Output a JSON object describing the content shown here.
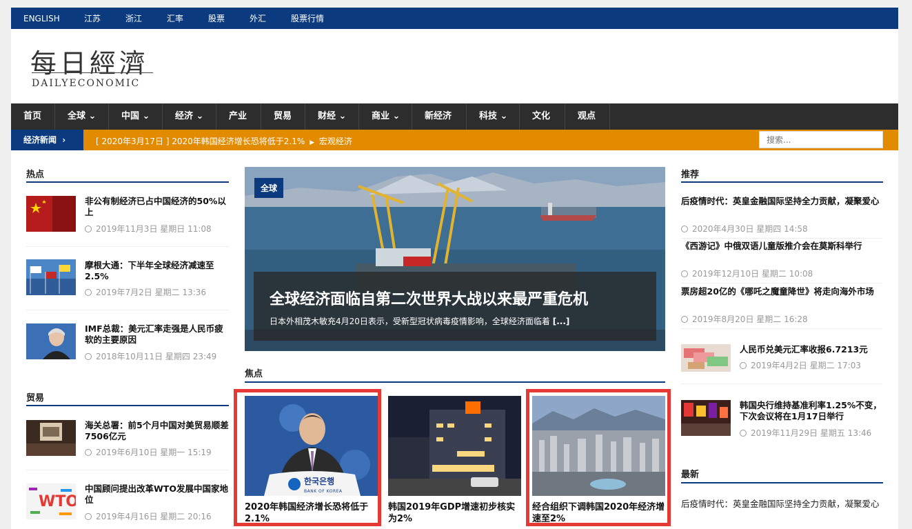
{
  "topbar": {
    "items": [
      "ENGLISH",
      "江苏",
      "浙江",
      "汇率",
      "股票",
      "外汇",
      "股票行情"
    ]
  },
  "logo": {
    "cn": "每日經濟",
    "en": "DAILYECONOMIC"
  },
  "nav": {
    "items": [
      "首页",
      "全球",
      "中国",
      "经济",
      "产业",
      "贸易",
      "财经",
      "商业",
      "新经济",
      "科技",
      "文化",
      "观点"
    ]
  },
  "ticker": {
    "label": "经济新闻",
    "date": "[ 2020年3月17日 ]",
    "headline": "2020年韩国经济增长恐将低于2.1%",
    "category": "宏观经济"
  },
  "search": {
    "placeholder": "搜索..."
  },
  "hot": {
    "heading": "热点",
    "items": [
      {
        "title": "非公有制经济已占中国经济的50%以上",
        "meta": "2019年11月3日 星期日 11:08"
      },
      {
        "title": "摩根大通：下半年全球经济减速至2.5%",
        "meta": "2019年7月2日 星期二 13:36"
      },
      {
        "title": "IMF总裁：美元汇率走强是人民币疲软的主要原因",
        "meta": "2018年10月11日 星期四 23:49"
      }
    ]
  },
  "trade": {
    "heading": "贸易",
    "items": [
      {
        "title": "海关总署：前5个月中国对美贸易顺差7506亿元",
        "meta": "2019年6月10日 星期一 15:19"
      },
      {
        "title": "中国顾问提出改革WTO发展中国家地位",
        "meta": "2019年4月16日 星期二 20:16"
      }
    ]
  },
  "hero": {
    "badge": "全球",
    "title": "全球经济面临自第二次世界大战以来最严重危机",
    "desc": "日本外相茂木敏充4月20日表示，受新型冠状病毒疫情影响，全球经济面临着",
    "more": "[...]"
  },
  "focus": {
    "heading": "焦点",
    "items": [
      {
        "title": "2020年韩国经济增长恐将低于2.1%",
        "sign": "한국은행",
        "sign_en": "BANK OF KOREA"
      },
      {
        "title": "韩国2019年GDP增速初步核实为2%"
      },
      {
        "title": "经合组织下调韩国2020年经济增速至2%"
      }
    ]
  },
  "recommend": {
    "heading": "推荐",
    "items": [
      {
        "title": "后疫情时代：英皇金融国际坚持全力贡献，凝聚爱心",
        "meta": "2020年4月30日 星期四 14:58"
      },
      {
        "title": "《西游记》中俄双语儿童版推介会在莫斯科举行",
        "meta": "2019年12月10日 星期二 10:08"
      },
      {
        "title": "票房超20亿的《哪吒之魔童降世》将走向海外市场",
        "meta": "2019年8月20日 星期二 16:28"
      },
      {
        "title": "人民币兑美元汇率收报6.7213元",
        "meta": "2019年4月2日 星期二 17:03"
      },
      {
        "title": "韩国央行维持基准利率1.25%不变，下次会议将在1月17日举行",
        "meta": "2019年11月29日 星期五 13:46"
      }
    ]
  },
  "latest": {
    "heading": "最新",
    "items": [
      {
        "title": "后疫情时代：英皇金融国际坚持全力贡献，凝聚爱心"
      }
    ]
  },
  "colors": {
    "primary": "#0b3a7e",
    "accent": "#e38b00",
    "nav": "#2d2d2d",
    "highlight": "#e53935"
  }
}
